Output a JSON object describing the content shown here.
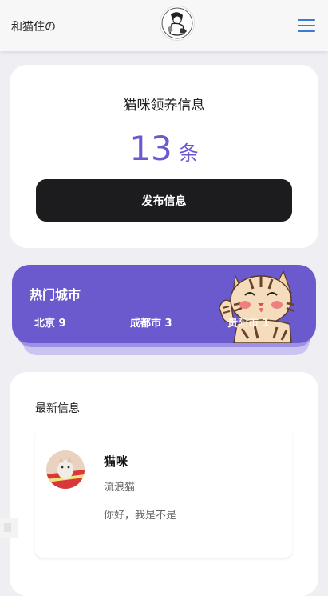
{
  "header": {
    "brand": "和猫住の",
    "logo_icon": "cat-person-logo-icon",
    "menu_icon": "hamburger-menu-icon"
  },
  "stats": {
    "title": "猫咪领养信息",
    "count": "13",
    "unit": "条",
    "publish_label": "发布信息"
  },
  "hot_cities": {
    "title": "热门城市",
    "cities": [
      {
        "label": "北京 9"
      },
      {
        "label": "成都市 3"
      },
      {
        "label": "贵阳市 1"
      }
    ]
  },
  "latest": {
    "title": "最新信息",
    "posts": [
      {
        "name": "猫咪",
        "tag": "流浪猫",
        "desc": "你好，我是不是"
      }
    ]
  },
  "colors": {
    "accent": "#6a5acd",
    "button_dark": "#1c1c1f",
    "menu_blue": "#3a7bd5",
    "background": "#efeef3"
  }
}
